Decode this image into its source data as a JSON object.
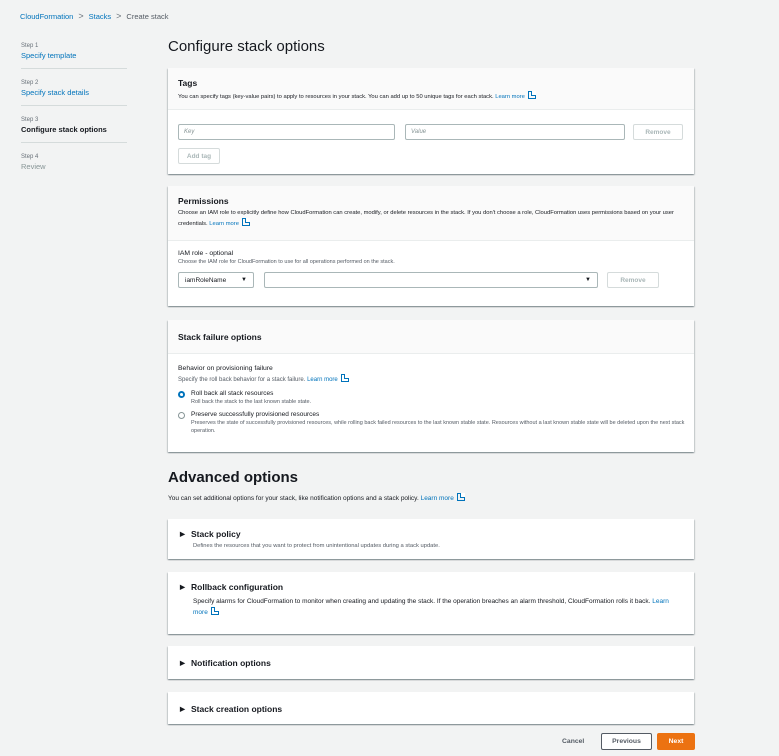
{
  "breadcrumb": {
    "items": [
      "CloudFormation",
      "Stacks"
    ],
    "current": "Create stack",
    "sep": ">"
  },
  "steps": [
    {
      "num": "Step 1",
      "label": "Specify template"
    },
    {
      "num": "Step 2",
      "label": "Specify stack details"
    },
    {
      "num": "Step 3",
      "label": "Configure stack options"
    },
    {
      "num": "Step 4",
      "label": "Review"
    }
  ],
  "page_title": "Configure stack options",
  "tags": {
    "title": "Tags",
    "desc": "You can specify tags (key-value pairs) to apply to resources in your stack. You can add up to 50 unique tags for each stack.",
    "learn_more": "Learn more",
    "key_placeholder": "Key",
    "value_placeholder": "Value",
    "remove": "Remove",
    "add_tag": "Add tag"
  },
  "permissions": {
    "title": "Permissions",
    "desc": "Choose an IAM role to explicitly define how CloudFormation can create, modify, or delete resources in the stack. If you don't choose a role, CloudFormation uses permissions based on your user credentials.",
    "learn_more": "Learn more",
    "iam_label": "IAM role - optional",
    "iam_desc": "Choose the IAM role for CloudFormation to use for all operations performed on the stack.",
    "iam_type": "iamRoleName",
    "remove": "Remove"
  },
  "failure": {
    "title": "Stack failure options",
    "behavior_label": "Behavior on provisioning failure",
    "behavior_desc": "Specify the roll back behavior for a stack failure.",
    "learn_more": "Learn more",
    "opt1_title": "Roll back all stack resources",
    "opt1_desc": "Roll back the stack to the last known stable state.",
    "opt2_title": "Preserve successfully provisioned resources",
    "opt2_desc": "Preserves the state of successfully provisioned resources, while rolling back failed resources to the last known stable state. Resources without a last known stable state will be deleted upon the next stack operation."
  },
  "advanced": {
    "title": "Advanced options",
    "desc": "You can set additional options for your stack, like notification options and a stack policy.",
    "learn_more": "Learn more",
    "stack_policy_title": "Stack policy",
    "stack_policy_desc": "Defines the resources that you want to protect from unintentional updates during a stack update.",
    "rollback_title": "Rollback configuration",
    "rollback_desc": "Specify alarms for CloudFormation to monitor when creating and updating the stack. If the operation breaches an alarm threshold, CloudFormation rolls it back.",
    "rollback_learn": "Learn more",
    "notification_title": "Notification options",
    "creation_title": "Stack creation options"
  },
  "footer": {
    "cancel": "Cancel",
    "previous": "Previous",
    "next": "Next"
  },
  "colors": {
    "link": "#0073bb",
    "primary": "#ec7211",
    "background": "#f2f3f3"
  }
}
